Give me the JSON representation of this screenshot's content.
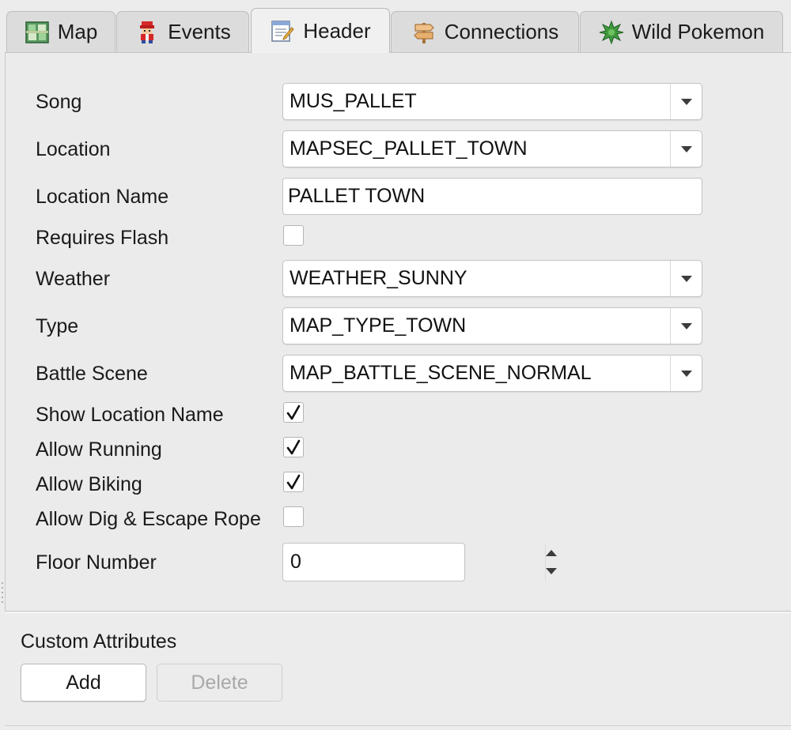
{
  "tabs": [
    {
      "label": "Map",
      "icon": "map-icon",
      "active": false
    },
    {
      "label": "Events",
      "icon": "trainer-sprite-icon",
      "active": false
    },
    {
      "label": "Header",
      "icon": "edit-document-icon",
      "active": true
    },
    {
      "label": "Connections",
      "icon": "signpost-icon",
      "active": false
    },
    {
      "label": "Wild Pokemon",
      "icon": "grass-icon",
      "active": false
    }
  ],
  "header": {
    "song": {
      "label": "Song",
      "value": "MUS_PALLET"
    },
    "location": {
      "label": "Location",
      "value": "MAPSEC_PALLET_TOWN"
    },
    "location_name": {
      "label": "Location Name",
      "value": "PALLET TOWN"
    },
    "requires_flash": {
      "label": "Requires Flash",
      "checked": false
    },
    "weather": {
      "label": "Weather",
      "value": "WEATHER_SUNNY"
    },
    "type": {
      "label": "Type",
      "value": "MAP_TYPE_TOWN"
    },
    "battle_scene": {
      "label": "Battle Scene",
      "value": "MAP_BATTLE_SCENE_NORMAL"
    },
    "show_location_name": {
      "label": "Show Location Name",
      "checked": true
    },
    "allow_running": {
      "label": "Allow Running",
      "checked": true
    },
    "allow_biking": {
      "label": "Allow Biking",
      "checked": true
    },
    "allow_dig_escape_rope": {
      "label": "Allow Dig & Escape Rope",
      "checked": false
    },
    "floor_number": {
      "label": "Floor Number",
      "value": "0"
    }
  },
  "custom_attributes": {
    "title": "Custom Attributes",
    "add_label": "Add",
    "delete_label": "Delete",
    "delete_enabled": false
  },
  "colors": {
    "window_bg": "#ececec",
    "tab_active_bg": "#f0f0f0",
    "tab_inactive_bg": "#dcdcdc",
    "disabled_text": "#a9a9a9"
  }
}
